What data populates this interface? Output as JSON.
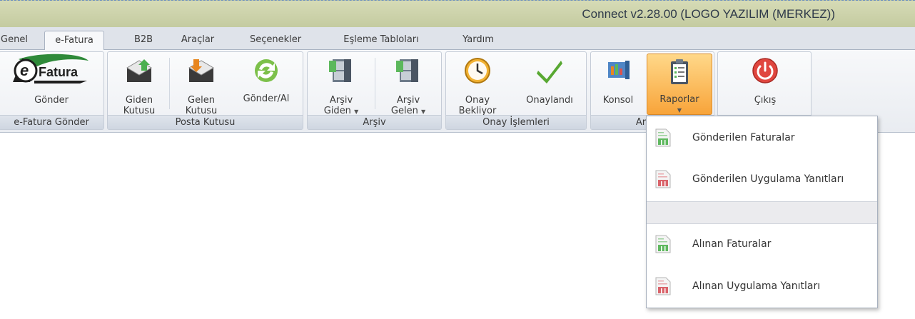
{
  "window": {
    "title": "Connect v2.28.00 (LOGO YAZILIM (MERKEZ))"
  },
  "tabs": [
    {
      "label": "Genel"
    },
    {
      "label": "e-Fatura"
    },
    {
      "label": "B2B"
    },
    {
      "label": "Araçlar"
    },
    {
      "label": "Seçenekler"
    },
    {
      "label": "Eşleme Tabloları"
    },
    {
      "label": "Yardım"
    }
  ],
  "ribbon": {
    "efatura_gonder": {
      "logo_text": "Fatura",
      "gonder_label": "Gönder",
      "group_label": "e-Fatura Gönder"
    },
    "posta_kutusu": {
      "giden_label": "Giden\nKutusu",
      "gelen_label": "Gelen\nKutusu",
      "gonderal_label": "Gönder/Al",
      "group_label": "Posta Kutusu"
    },
    "arsiv": {
      "giden_label": "Arşiv\nGiden",
      "gelen_label": "Arşiv\nGelen",
      "group_label": "Arşiv"
    },
    "onay": {
      "bekliyor_label": "Onay\nBekliyor",
      "onaylandi_label": "Onaylandı",
      "group_label": "Onay İşlemleri"
    },
    "araclar": {
      "konsol_label": "Konsol",
      "raporlar_label": "Raporlar",
      "group_label": "Araçlar"
    },
    "cikis": {
      "cikis_label": "Çıkış"
    }
  },
  "raporlar_menu": {
    "items": [
      {
        "label": "Gönderilen Faturalar",
        "color": "#5fb85f"
      },
      {
        "label": "Gönderilen Uygulama Yanıtları",
        "color": "#d9636a"
      },
      {
        "label": "Alınan Faturalar",
        "color": "#5fb85f"
      },
      {
        "label": "Alınan Uygulama Yanıtları",
        "color": "#d9636a"
      }
    ]
  },
  "colors": {
    "title_bg": "#c9cfa6",
    "highlight": "#f8a43a",
    "power": "#e0463f"
  }
}
